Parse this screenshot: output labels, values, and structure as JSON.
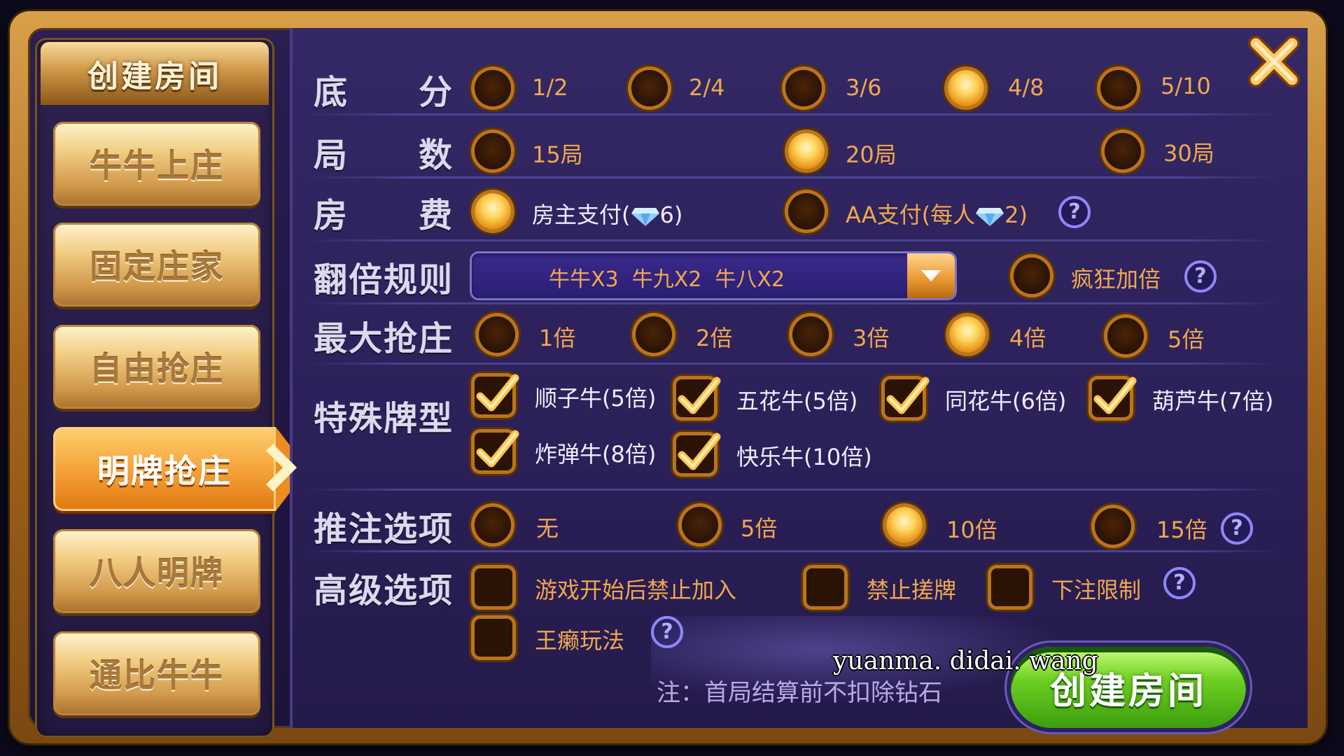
{
  "sidebar": {
    "title": "创建房间",
    "items": [
      {
        "label": "牛牛上庄"
      },
      {
        "label": "固定庄家"
      },
      {
        "label": "自由抢庄"
      },
      {
        "label": "明牌抢庄",
        "active": true
      },
      {
        "label": "八人明牌"
      },
      {
        "label": "通比牛牛"
      }
    ]
  },
  "rows": {
    "base_score": {
      "label": "底　　分",
      "options": [
        "1/2",
        "2/4",
        "3/6",
        "4/8",
        "5/10"
      ],
      "selected": "4/8"
    },
    "rounds": {
      "label": "局　　数",
      "options": [
        "15局",
        "20局",
        "30局"
      ],
      "selected": "20局"
    },
    "room_fee": {
      "label": "房　　费",
      "options": [
        "房主支付(",
        "6)",
        "AA支付(每人",
        "2)"
      ],
      "selected": "房主支付"
    },
    "multiplier": {
      "label": "翻倍规则",
      "dropdown_value": "牛牛X3  牛九X2  牛八X2",
      "extra_option": "疯狂加倍"
    },
    "max_banker": {
      "label": "最大抢庄",
      "options": [
        "1倍",
        "2倍",
        "3倍",
        "4倍",
        "5倍"
      ],
      "selected": "4倍"
    },
    "special": {
      "label": "特殊牌型",
      "options": [
        "顺子牛(5倍)",
        "五花牛(5倍)",
        "同花牛(6倍)",
        "葫芦牛(7倍)",
        "炸弹牛(8倍)",
        "快乐牛(10倍)"
      ]
    },
    "push_bet": {
      "label": "推注选项",
      "options": [
        "无",
        "5倍",
        "10倍",
        "15倍"
      ],
      "selected": "10倍"
    },
    "advanced": {
      "label": "高级选项",
      "options": [
        "游戏开始后禁止加入",
        "禁止搓牌",
        "下注限制",
        "王癞玩法"
      ]
    }
  },
  "help_symbol": "?",
  "note": "注：首局结算前不扣除钻石",
  "create_button": "创建房间",
  "watermark": "yuanma. didai. wang",
  "colors": {
    "accent": "#f0a84e",
    "active_tab": "#f5a43a",
    "create": "#6fd024",
    "help": "#8f86ff"
  }
}
